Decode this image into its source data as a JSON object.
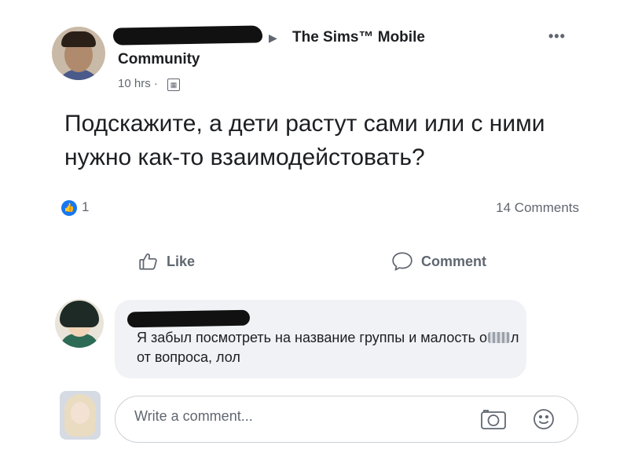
{
  "post": {
    "group_name": "The Sims™ Mobile",
    "group_suffix": "Community",
    "time": "10 hrs ·",
    "text": "Подскажите, а дети растут сами или с ними нужно как-то взаимодейстовать?",
    "like_count": "1",
    "comments_count": "14 Comments"
  },
  "actions": {
    "like_label": "Like",
    "comment_label": "Comment"
  },
  "comment": {
    "text_before": "Я забыл посмотреть на название группы и малость о",
    "text_after": "л от вопроса, лол"
  },
  "composer": {
    "placeholder": "Write a comment..."
  },
  "colors": {
    "like_badge": "#1877f2",
    "bubble_bg": "#f0f2f5",
    "secondary_text": "#606770"
  },
  "icons": {
    "globe": "globe-icon",
    "more": "more-icon",
    "like": "thumb-up-icon",
    "comment": "speech-bubble-icon",
    "camera": "camera-icon",
    "emoji": "smiley-icon"
  }
}
